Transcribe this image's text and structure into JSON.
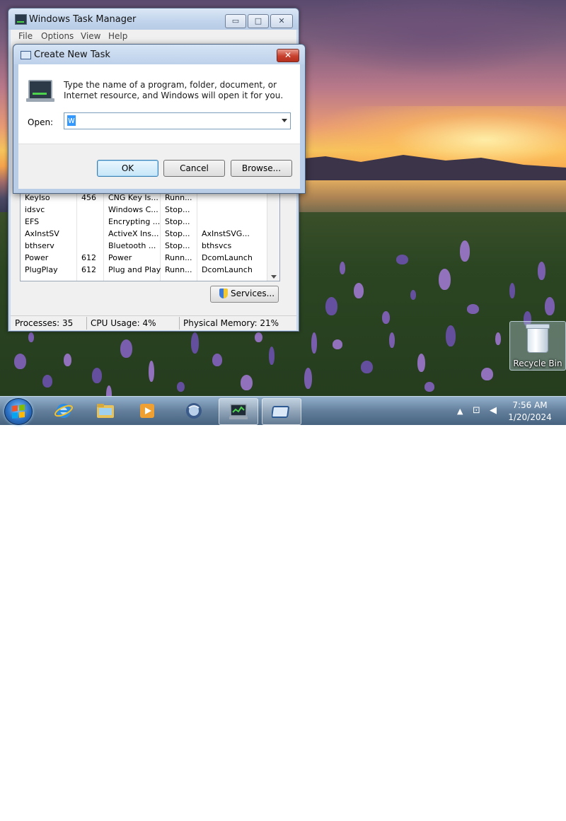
{
  "task_manager": {
    "title": "Windows Task Manager",
    "menu": [
      "File",
      "Options",
      "View",
      "Help"
    ],
    "rows": [
      [
        "KeyIso",
        "456",
        "CNG Key Is...",
        "Runn...",
        ""
      ],
      [
        "idsvc",
        "",
        "Windows C...",
        "Stop...",
        ""
      ],
      [
        "EFS",
        "",
        "Encrypting ...",
        "Stop...",
        ""
      ],
      [
        "AxInstSV",
        "",
        "ActiveX Ins...",
        "Stop...",
        "AxInstSVG..."
      ],
      [
        "bthserv",
        "",
        "Bluetooth ...",
        "Stop...",
        "bthsvcs"
      ],
      [
        "Power",
        "612",
        "Power",
        "Runn...",
        "DcomLaunch"
      ],
      [
        "PlugPlay",
        "612",
        "Plug and Play",
        "Runn...",
        "DcomLaunch"
      ]
    ],
    "services_button": "Services...",
    "status": {
      "processes": "Processes: 35",
      "cpu": "CPU Usage: 4%",
      "memory": "Physical Memory: 21%"
    }
  },
  "dialog": {
    "title": "Create New Task",
    "description": "Type the name of a program, folder, document, or Internet resource, and Windows will open it for you.",
    "open_label": "Open:",
    "open_value": "w",
    "ok": "OK",
    "cancel": "Cancel",
    "browse": "Browse..."
  },
  "desktop": {
    "recycle_bin": "Recycle Bin"
  },
  "taskbar": {
    "time": "7:56 AM",
    "date": "1/20/2024",
    "apps": [
      "internet-explorer-icon",
      "folder-icon",
      "media-player-icon",
      "browser-icon",
      "task-manager-icon",
      "run-dialog-icon"
    ]
  },
  "icons": {
    "minimize": "▭",
    "maximize": "□",
    "close": "✕",
    "tray_up": "▲",
    "network": "⊡",
    "volume": "◀"
  },
  "colors": {
    "accent": "#3399ff",
    "close_red": "#c8402e"
  }
}
